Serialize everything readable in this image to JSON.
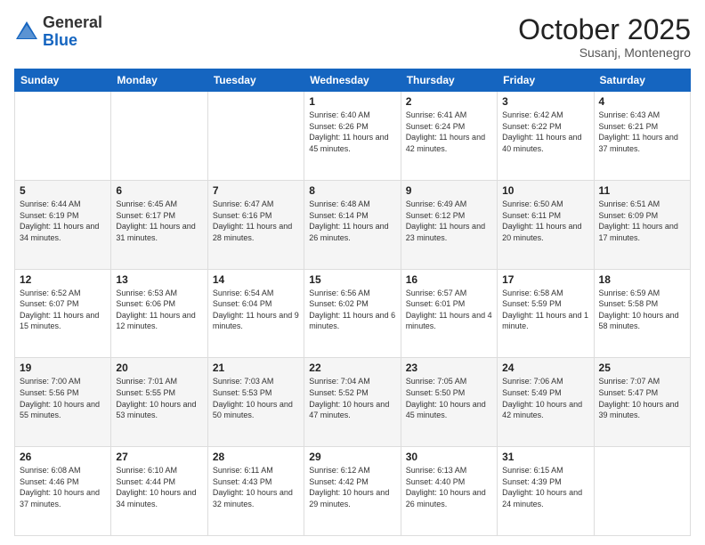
{
  "header": {
    "logo_general": "General",
    "logo_blue": "Blue",
    "title": "October 2025",
    "location": "Susanj, Montenegro"
  },
  "columns": [
    "Sunday",
    "Monday",
    "Tuesday",
    "Wednesday",
    "Thursday",
    "Friday",
    "Saturday"
  ],
  "weeks": [
    {
      "shaded": false,
      "days": [
        {
          "num": "",
          "info": ""
        },
        {
          "num": "",
          "info": ""
        },
        {
          "num": "",
          "info": ""
        },
        {
          "num": "1",
          "info": "Sunrise: 6:40 AM\nSunset: 6:26 PM\nDaylight: 11 hours and 45 minutes."
        },
        {
          "num": "2",
          "info": "Sunrise: 6:41 AM\nSunset: 6:24 PM\nDaylight: 11 hours and 42 minutes."
        },
        {
          "num": "3",
          "info": "Sunrise: 6:42 AM\nSunset: 6:22 PM\nDaylight: 11 hours and 40 minutes."
        },
        {
          "num": "4",
          "info": "Sunrise: 6:43 AM\nSunset: 6:21 PM\nDaylight: 11 hours and 37 minutes."
        }
      ]
    },
    {
      "shaded": true,
      "days": [
        {
          "num": "5",
          "info": "Sunrise: 6:44 AM\nSunset: 6:19 PM\nDaylight: 11 hours and 34 minutes."
        },
        {
          "num": "6",
          "info": "Sunrise: 6:45 AM\nSunset: 6:17 PM\nDaylight: 11 hours and 31 minutes."
        },
        {
          "num": "7",
          "info": "Sunrise: 6:47 AM\nSunset: 6:16 PM\nDaylight: 11 hours and 28 minutes."
        },
        {
          "num": "8",
          "info": "Sunrise: 6:48 AM\nSunset: 6:14 PM\nDaylight: 11 hours and 26 minutes."
        },
        {
          "num": "9",
          "info": "Sunrise: 6:49 AM\nSunset: 6:12 PM\nDaylight: 11 hours and 23 minutes."
        },
        {
          "num": "10",
          "info": "Sunrise: 6:50 AM\nSunset: 6:11 PM\nDaylight: 11 hours and 20 minutes."
        },
        {
          "num": "11",
          "info": "Sunrise: 6:51 AM\nSunset: 6:09 PM\nDaylight: 11 hours and 17 minutes."
        }
      ]
    },
    {
      "shaded": false,
      "days": [
        {
          "num": "12",
          "info": "Sunrise: 6:52 AM\nSunset: 6:07 PM\nDaylight: 11 hours and 15 minutes."
        },
        {
          "num": "13",
          "info": "Sunrise: 6:53 AM\nSunset: 6:06 PM\nDaylight: 11 hours and 12 minutes."
        },
        {
          "num": "14",
          "info": "Sunrise: 6:54 AM\nSunset: 6:04 PM\nDaylight: 11 hours and 9 minutes."
        },
        {
          "num": "15",
          "info": "Sunrise: 6:56 AM\nSunset: 6:02 PM\nDaylight: 11 hours and 6 minutes."
        },
        {
          "num": "16",
          "info": "Sunrise: 6:57 AM\nSunset: 6:01 PM\nDaylight: 11 hours and 4 minutes."
        },
        {
          "num": "17",
          "info": "Sunrise: 6:58 AM\nSunset: 5:59 PM\nDaylight: 11 hours and 1 minute."
        },
        {
          "num": "18",
          "info": "Sunrise: 6:59 AM\nSunset: 5:58 PM\nDaylight: 10 hours and 58 minutes."
        }
      ]
    },
    {
      "shaded": true,
      "days": [
        {
          "num": "19",
          "info": "Sunrise: 7:00 AM\nSunset: 5:56 PM\nDaylight: 10 hours and 55 minutes."
        },
        {
          "num": "20",
          "info": "Sunrise: 7:01 AM\nSunset: 5:55 PM\nDaylight: 10 hours and 53 minutes."
        },
        {
          "num": "21",
          "info": "Sunrise: 7:03 AM\nSunset: 5:53 PM\nDaylight: 10 hours and 50 minutes."
        },
        {
          "num": "22",
          "info": "Sunrise: 7:04 AM\nSunset: 5:52 PM\nDaylight: 10 hours and 47 minutes."
        },
        {
          "num": "23",
          "info": "Sunrise: 7:05 AM\nSunset: 5:50 PM\nDaylight: 10 hours and 45 minutes."
        },
        {
          "num": "24",
          "info": "Sunrise: 7:06 AM\nSunset: 5:49 PM\nDaylight: 10 hours and 42 minutes."
        },
        {
          "num": "25",
          "info": "Sunrise: 7:07 AM\nSunset: 5:47 PM\nDaylight: 10 hours and 39 minutes."
        }
      ]
    },
    {
      "shaded": false,
      "days": [
        {
          "num": "26",
          "info": "Sunrise: 6:08 AM\nSunset: 4:46 PM\nDaylight: 10 hours and 37 minutes."
        },
        {
          "num": "27",
          "info": "Sunrise: 6:10 AM\nSunset: 4:44 PM\nDaylight: 10 hours and 34 minutes."
        },
        {
          "num": "28",
          "info": "Sunrise: 6:11 AM\nSunset: 4:43 PM\nDaylight: 10 hours and 32 minutes."
        },
        {
          "num": "29",
          "info": "Sunrise: 6:12 AM\nSunset: 4:42 PM\nDaylight: 10 hours and 29 minutes."
        },
        {
          "num": "30",
          "info": "Sunrise: 6:13 AM\nSunset: 4:40 PM\nDaylight: 10 hours and 26 minutes."
        },
        {
          "num": "31",
          "info": "Sunrise: 6:15 AM\nSunset: 4:39 PM\nDaylight: 10 hours and 24 minutes."
        },
        {
          "num": "",
          "info": ""
        }
      ]
    }
  ]
}
